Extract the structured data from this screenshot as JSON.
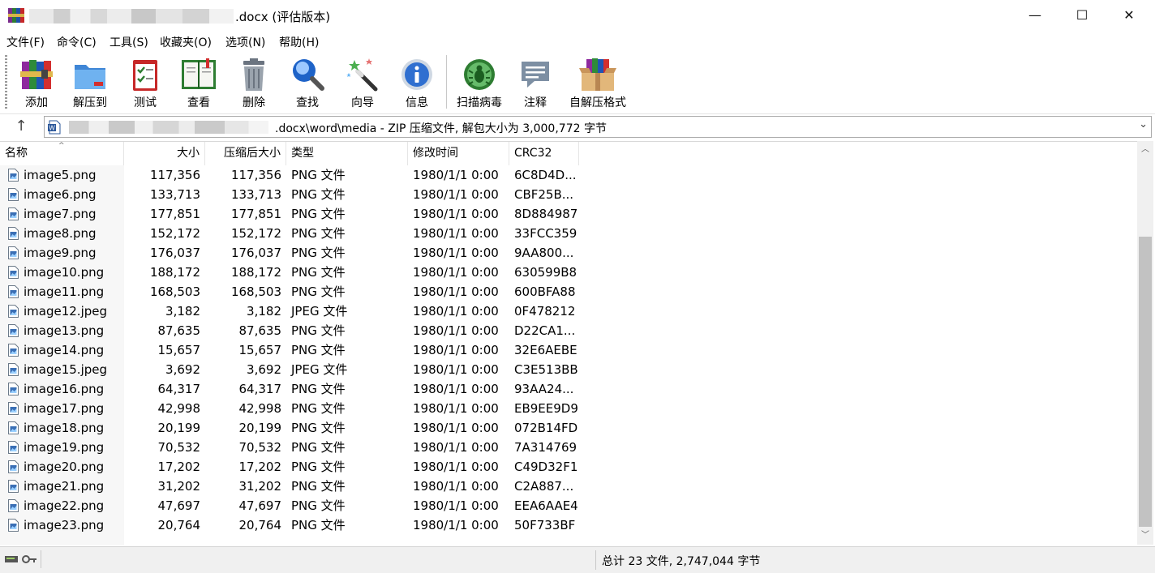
{
  "window": {
    "title_suffix": ".docx (评估版本)",
    "minimize_glyph": "—",
    "maximize_glyph": "☐",
    "close_glyph": "✕"
  },
  "menu": [
    "文件(F)",
    "命令(C)",
    "工具(S)",
    "收藏夹(O)",
    "选项(N)",
    "帮助(H)"
  ],
  "toolbar": [
    {
      "label": "添加",
      "icon": "add-archive-icon"
    },
    {
      "label": "解压到",
      "icon": "extract-folder-icon"
    },
    {
      "label": "测试",
      "icon": "test-clipboard-icon"
    },
    {
      "label": "查看",
      "icon": "view-book-icon"
    },
    {
      "label": "删除",
      "icon": "trash-icon"
    },
    {
      "label": "查找",
      "icon": "magnifier-icon"
    },
    {
      "label": "向导",
      "icon": "wizard-wand-icon"
    },
    {
      "label": "信息",
      "icon": "info-icon"
    },
    {
      "label": "扫描病毒",
      "icon": "virus-scan-icon"
    },
    {
      "label": "注释",
      "icon": "comment-icon"
    },
    {
      "label": "自解压格式",
      "icon": "sfx-box-icon"
    }
  ],
  "address": {
    "path_text": ".docx\\word\\media - ZIP 压缩文件, 解包大小为 3,000,772 字节"
  },
  "columns": {
    "name": "名称",
    "size": "大小",
    "packed": "压缩后大小",
    "type": "类型",
    "modified": "修改时间",
    "crc": "CRC32"
  },
  "files": [
    {
      "name": "image5.png",
      "size": "117,356",
      "packed": "117,356",
      "type": "PNG 文件",
      "modified": "1980/1/1 0:00",
      "crc": "6C8D4D..."
    },
    {
      "name": "image6.png",
      "size": "133,713",
      "packed": "133,713",
      "type": "PNG 文件",
      "modified": "1980/1/1 0:00",
      "crc": "CBF25B..."
    },
    {
      "name": "image7.png",
      "size": "177,851",
      "packed": "177,851",
      "type": "PNG 文件",
      "modified": "1980/1/1 0:00",
      "crc": "8D884987"
    },
    {
      "name": "image8.png",
      "size": "152,172",
      "packed": "152,172",
      "type": "PNG 文件",
      "modified": "1980/1/1 0:00",
      "crc": "33FCC359"
    },
    {
      "name": "image9.png",
      "size": "176,037",
      "packed": "176,037",
      "type": "PNG 文件",
      "modified": "1980/1/1 0:00",
      "crc": "9AA800..."
    },
    {
      "name": "image10.png",
      "size": "188,172",
      "packed": "188,172",
      "type": "PNG 文件",
      "modified": "1980/1/1 0:00",
      "crc": "630599B8"
    },
    {
      "name": "image11.png",
      "size": "168,503",
      "packed": "168,503",
      "type": "PNG 文件",
      "modified": "1980/1/1 0:00",
      "crc": "600BFA88"
    },
    {
      "name": "image12.jpeg",
      "size": "3,182",
      "packed": "3,182",
      "type": "JPEG 文件",
      "modified": "1980/1/1 0:00",
      "crc": "0F478212"
    },
    {
      "name": "image13.png",
      "size": "87,635",
      "packed": "87,635",
      "type": "PNG 文件",
      "modified": "1980/1/1 0:00",
      "crc": "D22CA1..."
    },
    {
      "name": "image14.png",
      "size": "15,657",
      "packed": "15,657",
      "type": "PNG 文件",
      "modified": "1980/1/1 0:00",
      "crc": "32E6AEBE"
    },
    {
      "name": "image15.jpeg",
      "size": "3,692",
      "packed": "3,692",
      "type": "JPEG 文件",
      "modified": "1980/1/1 0:00",
      "crc": "C3E513BB"
    },
    {
      "name": "image16.png",
      "size": "64,317",
      "packed": "64,317",
      "type": "PNG 文件",
      "modified": "1980/1/1 0:00",
      "crc": "93AA24..."
    },
    {
      "name": "image17.png",
      "size": "42,998",
      "packed": "42,998",
      "type": "PNG 文件",
      "modified": "1980/1/1 0:00",
      "crc": "EB9EE9D9"
    },
    {
      "name": "image18.png",
      "size": "20,199",
      "packed": "20,199",
      "type": "PNG 文件",
      "modified": "1980/1/1 0:00",
      "crc": "072B14FD"
    },
    {
      "name": "image19.png",
      "size": "70,532",
      "packed": "70,532",
      "type": "PNG 文件",
      "modified": "1980/1/1 0:00",
      "crc": "7A314769"
    },
    {
      "name": "image20.png",
      "size": "17,202",
      "packed": "17,202",
      "type": "PNG 文件",
      "modified": "1980/1/1 0:00",
      "crc": "C49D32F1"
    },
    {
      "name": "image21.png",
      "size": "31,202",
      "packed": "31,202",
      "type": "PNG 文件",
      "modified": "1980/1/1 0:00",
      "crc": "C2A887..."
    },
    {
      "name": "image22.png",
      "size": "47,697",
      "packed": "47,697",
      "type": "PNG 文件",
      "modified": "1980/1/1 0:00",
      "crc": "EEA6AAE4"
    },
    {
      "name": "image23.png",
      "size": "20,764",
      "packed": "20,764",
      "type": "PNG 文件",
      "modified": "1980/1/1 0:00",
      "crc": "50F733BF"
    }
  ],
  "status": {
    "summary": "总计 23 文件, 2,747,044 字节"
  }
}
